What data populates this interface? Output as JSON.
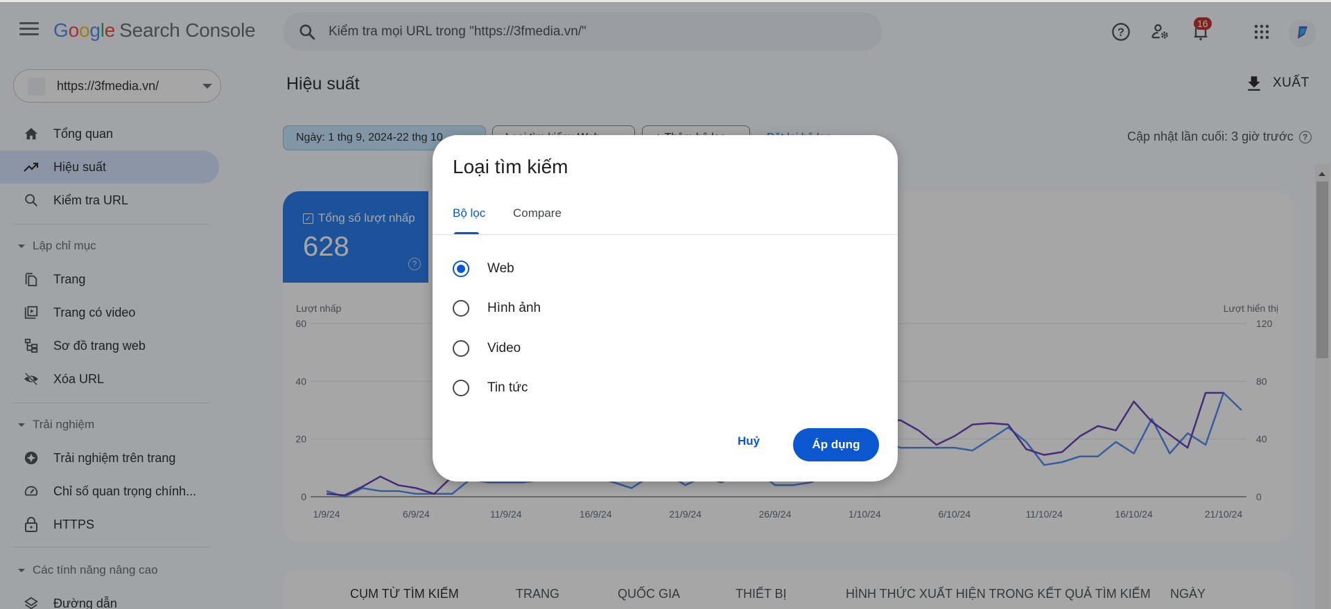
{
  "header": {
    "logo_letters": [
      "G",
      "o",
      "o",
      "g",
      "l",
      "e"
    ],
    "product": "Search Console",
    "search_placeholder": "Kiểm tra mọi URL trong \"https://3fmedia.vn/\"",
    "notification_count": "16",
    "icons": [
      "menu-icon",
      "search-icon",
      "help-icon",
      "manage-users-icon",
      "notifications-icon",
      "apps-icon",
      "account-avatar"
    ]
  },
  "sidebar": {
    "property": "https://3fmedia.vn/",
    "top_items": [
      {
        "label": "Tổng quan",
        "icon": "home-icon"
      },
      {
        "label": "Hiệu suất",
        "icon": "trending-up-icon",
        "active": true
      },
      {
        "label": "Kiểm tra URL",
        "icon": "search-icon"
      }
    ],
    "sections": [
      {
        "title": "Lập chỉ mục",
        "items": [
          {
            "label": "Trang",
            "icon": "pages-icon"
          },
          {
            "label": "Trang có video",
            "icon": "video-pages-icon"
          },
          {
            "label": "Sơ đồ trang web",
            "icon": "sitemap-icon"
          },
          {
            "label": "Xóa URL",
            "icon": "visibility-off-icon"
          }
        ]
      },
      {
        "title": "Trải nghiệm",
        "items": [
          {
            "label": "Trải nghiệm trên trang",
            "icon": "page-experience-icon"
          },
          {
            "label": "Chỉ số quan trọng chính...",
            "icon": "speed-icon"
          },
          {
            "label": "HTTPS",
            "icon": "lock-icon"
          }
        ]
      },
      {
        "title": "Các tính năng nâng cao",
        "items": [
          {
            "label": "Đường dẫn",
            "icon": "layers-icon"
          }
        ]
      }
    ]
  },
  "main": {
    "title": "Hiệu suất",
    "export_label": "XUẤT",
    "filters": {
      "date": "Ngày: 1 thg 9, 2024-22 thg 10",
      "search_type": "Loại tìm kiếm: Web",
      "add_filter": "+ Thêm bộ lọc",
      "reset": "Đặt lại bộ lọc"
    },
    "last_updated": "Cập nhật lần cuối: 3 giờ trước",
    "metric": {
      "label": "Tổng số lượt nhấp",
      "value": "628"
    },
    "table_tabs": [
      "CỤM TỪ TÌM KIẾM",
      "TRANG",
      "QUỐC GIA",
      "THIẾT BỊ",
      "HÌNH THỨC XUẤT HIỆN TRONG KẾT QUẢ TÌM KIẾM",
      "NGÀY"
    ]
  },
  "dialog": {
    "title": "Loại tìm kiếm",
    "tabs": [
      "Bộ lọc",
      "Compare"
    ],
    "active_tab": 0,
    "options": [
      "Web",
      "Hình ảnh",
      "Video",
      "Tin tức"
    ],
    "selected": "Web",
    "cancel_label": "Huỷ",
    "apply_label": "Áp dụng"
  },
  "chart_data": {
    "type": "line",
    "title": "",
    "left_axis_label": "Lượt nhấp",
    "right_axis_label": "Lượt hiển thị",
    "left_ylim": [
      0,
      60
    ],
    "right_ylim": [
      0,
      120
    ],
    "left_ticks": [
      "0",
      "20",
      "40",
      "60"
    ],
    "right_ticks": [
      "0",
      "40",
      "80",
      "120"
    ],
    "x_tick_labels": [
      "1/9/24",
      "6/9/24",
      "11/9/24",
      "16/9/24",
      "21/9/24",
      "26/9/24",
      "1/10/24",
      "6/10/24",
      "11/10/24",
      "16/10/24",
      "21/10/24"
    ],
    "x_tick_day_index": [
      0,
      5,
      10,
      15,
      20,
      25,
      30,
      35,
      40,
      45,
      50
    ],
    "grid": true,
    "series": [
      {
        "name": "Lượt nhấp",
        "axis": "left",
        "color": "#4285f4",
        "values": [
          2,
          0,
          3,
          2,
          2,
          1,
          1,
          1,
          6,
          5,
          5,
          5,
          6,
          8,
          9,
          7,
          5,
          3,
          7,
          8,
          4,
          7,
          5,
          8,
          9,
          4,
          4,
          5,
          8,
          12,
          26,
          19,
          17,
          17,
          17,
          17,
          16,
          20,
          24,
          19,
          11,
          12,
          14,
          14,
          19,
          15,
          27,
          15,
          22,
          18,
          36,
          30
        ]
      },
      {
        "name": "Lượt hiển thị",
        "axis": "right",
        "color": "#5e35b1",
        "values": [
          2,
          1,
          7,
          14,
          8,
          6,
          2,
          14,
          22,
          20,
          18,
          20,
          22,
          26,
          28,
          24,
          20,
          16,
          22,
          24,
          18,
          20,
          16,
          22,
          24,
          18,
          20,
          22,
          30,
          40,
          70,
          53,
          53,
          46,
          36,
          42,
          50,
          51,
          50,
          33,
          29,
          31,
          42,
          49,
          46,
          66,
          52,
          43,
          34,
          72,
          72
        ]
      }
    ]
  }
}
